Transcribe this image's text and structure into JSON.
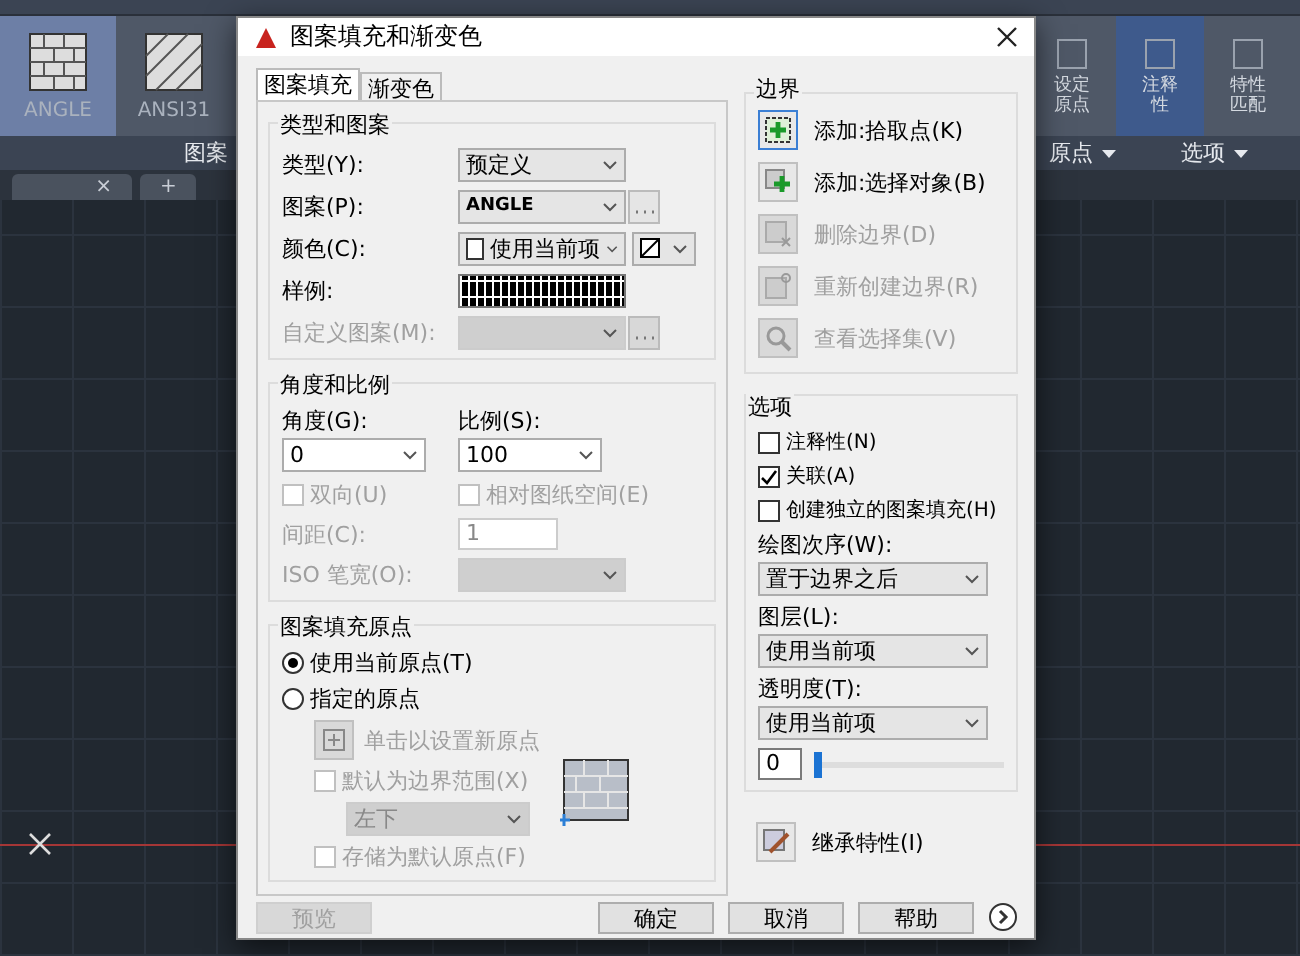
{
  "ribbon": {
    "patterns": [
      {
        "label": "ANGLE",
        "selected": true
      },
      {
        "label": "ANSI31",
        "selected": false
      }
    ],
    "panel_label": "图案",
    "tools": [
      {
        "label": "设定原点",
        "selected": false
      },
      {
        "label": "注释性",
        "selected": true
      },
      {
        "label": "特性匹配",
        "selected": false
      }
    ],
    "right_panels": [
      "原点",
      "选项"
    ]
  },
  "doc_tabs": {
    "close": "×",
    "add": "+"
  },
  "dialog": {
    "title": "图案填充和渐变色",
    "tabs": [
      {
        "label": "图案填充",
        "selected": true
      },
      {
        "label": "渐变色",
        "selected": false
      }
    ],
    "type_group": {
      "title": "类型和图案",
      "rows": [
        {
          "kind": "select",
          "label": "类型(Y):",
          "value": "预定义",
          "disabled": false
        },
        {
          "kind": "browse",
          "label": "图案(P):",
          "value": "ANGLE",
          "disabled": false
        },
        {
          "kind": "color",
          "label": "颜色(C):",
          "value": "使用当前项",
          "disabled": false
        },
        {
          "kind": "swatch",
          "label": "样例:",
          "disabled": false
        },
        {
          "kind": "browse",
          "label": "自定义图案(M):",
          "disabled": true
        }
      ]
    },
    "angle_group": {
      "title": "角度和比例",
      "angle": {
        "label": "角度(G):",
        "value": "0"
      },
      "scale": {
        "label": "比例(S):",
        "value": "100"
      },
      "checks": [
        {
          "label": "双向(U)",
          "checked": false,
          "disabled": true
        },
        {
          "label": "相对图纸空间(E)",
          "checked": false,
          "disabled": true
        }
      ],
      "spacing": {
        "label": "间距(C):",
        "value": "1",
        "disabled": true
      },
      "iso": {
        "label": "ISO 笔宽(O):",
        "disabled": true
      }
    },
    "origin_group": {
      "title": "图案填充原点",
      "radios": [
        {
          "label": "使用当前原点(T)",
          "selected": true
        },
        {
          "label": "指定的原点",
          "selected": false
        }
      ],
      "click_set": {
        "label": "单击以设置新原点",
        "disabled": true
      },
      "default_extent": {
        "label": "默认为边界范围(X)",
        "checked": false,
        "disabled": true
      },
      "position": {
        "value": "左下",
        "disabled": true
      },
      "store_default": {
        "label": "存储为默认原点(F)",
        "checked": false,
        "disabled": true
      }
    },
    "boundary": {
      "title": "边界",
      "buttons": [
        {
          "kind": "pick",
          "label": "添加:拾取点(K)",
          "disabled": false,
          "selected": true
        },
        {
          "kind": "select",
          "label": "添加:选择对象(B)",
          "disabled": false,
          "selected": false
        },
        {
          "kind": "remove",
          "label": "删除边界(D)",
          "disabled": true,
          "selected": false
        },
        {
          "kind": "recreate",
          "label": "重新创建边界(R)",
          "disabled": true,
          "selected": false
        },
        {
          "kind": "view",
          "label": "查看选择集(V)",
          "disabled": true,
          "selected": false
        }
      ]
    },
    "options": {
      "title": "选项",
      "checks": [
        {
          "label": "注释性(N)",
          "checked": false
        },
        {
          "label": "关联(A)",
          "checked": true
        },
        {
          "label": "创建独立的图案填充(H)",
          "checked": false
        }
      ],
      "draw_order": {
        "label": "绘图次序(W):",
        "value": "置于边界之后"
      },
      "layer": {
        "label": "图层(L):",
        "value": "使用当前项"
      },
      "transparency": {
        "label": "透明度(T):",
        "value": "使用当前项",
        "amount": "0",
        "level": 0
      }
    },
    "inherit": {
      "label": "继承特性(I)"
    },
    "footer": [
      {
        "label": "预览",
        "disabled": true
      },
      {
        "label": "确定",
        "disabled": false
      },
      {
        "label": "取消",
        "disabled": false
      },
      {
        "label": "帮助",
        "disabled": false
      }
    ]
  }
}
